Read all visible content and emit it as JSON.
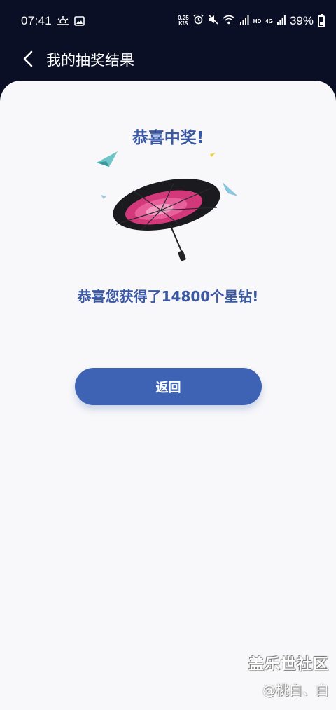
{
  "status_bar": {
    "time": "07:41",
    "net_speed_value": "0.25",
    "net_speed_unit": "K/S",
    "signal_label_hd": "HD",
    "signal_label_4g": "4G",
    "battery": "39%",
    "icons": [
      "weather-icon",
      "image-icon",
      "alarm-icon",
      "mute-icon",
      "wifi-icon",
      "signal-icon",
      "battery-icon"
    ]
  },
  "header": {
    "title": "我的抽奖结果",
    "back_icon": "chevron-left-icon"
  },
  "result": {
    "title": "恭喜中奖!",
    "message": "恭喜您获得了14800个星钻!",
    "button_label": "返回"
  },
  "watermark": {
    "brand": "盖乐世社区",
    "user": "@桃白、白"
  },
  "colors": {
    "background_dark": "#0b0f26",
    "card": "#f8f8fa",
    "accent_text": "#3b58a3",
    "button": "#3f63b4"
  }
}
